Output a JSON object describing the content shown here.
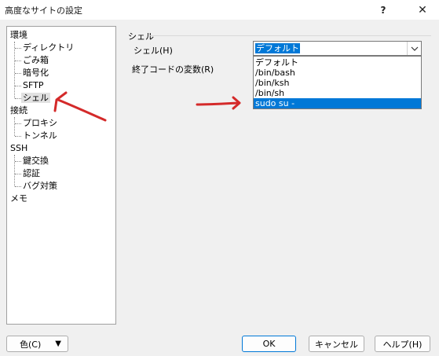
{
  "window": {
    "title": "高度なサイトの設定",
    "help": "?",
    "close": "✕"
  },
  "tree": {
    "sections": [
      {
        "label": "環境",
        "children": [
          "ディレクトリ",
          "ごみ箱",
          "暗号化",
          "SFTP",
          "シェル"
        ]
      },
      {
        "label": "接続",
        "children": [
          "プロキシ",
          "トンネル"
        ]
      },
      {
        "label": "SSH",
        "children": [
          "鍵交換",
          "認証",
          "バグ対策"
        ]
      },
      {
        "label": "メモ",
        "children": []
      }
    ],
    "selected": "シェル"
  },
  "shell_panel": {
    "group_label": "シェル",
    "shell_label": "シェル(H)",
    "exit_code_label": "終了コードの変数(R)",
    "combo_value": "デフォルト",
    "options": [
      "デフォルト",
      "/bin/bash",
      "/bin/ksh",
      "/bin/sh",
      "sudo su -"
    ],
    "highlighted_option": "sudo su -"
  },
  "buttons": {
    "color": "色(C)",
    "ok": "OK",
    "cancel": "キャンセル",
    "help": "ヘルプ(H)"
  },
  "annotations": {
    "color": "#d42a2a"
  },
  "icons": {
    "dropdown": "chevron-down-icon",
    "color_menu": "triangle-down-icon"
  }
}
